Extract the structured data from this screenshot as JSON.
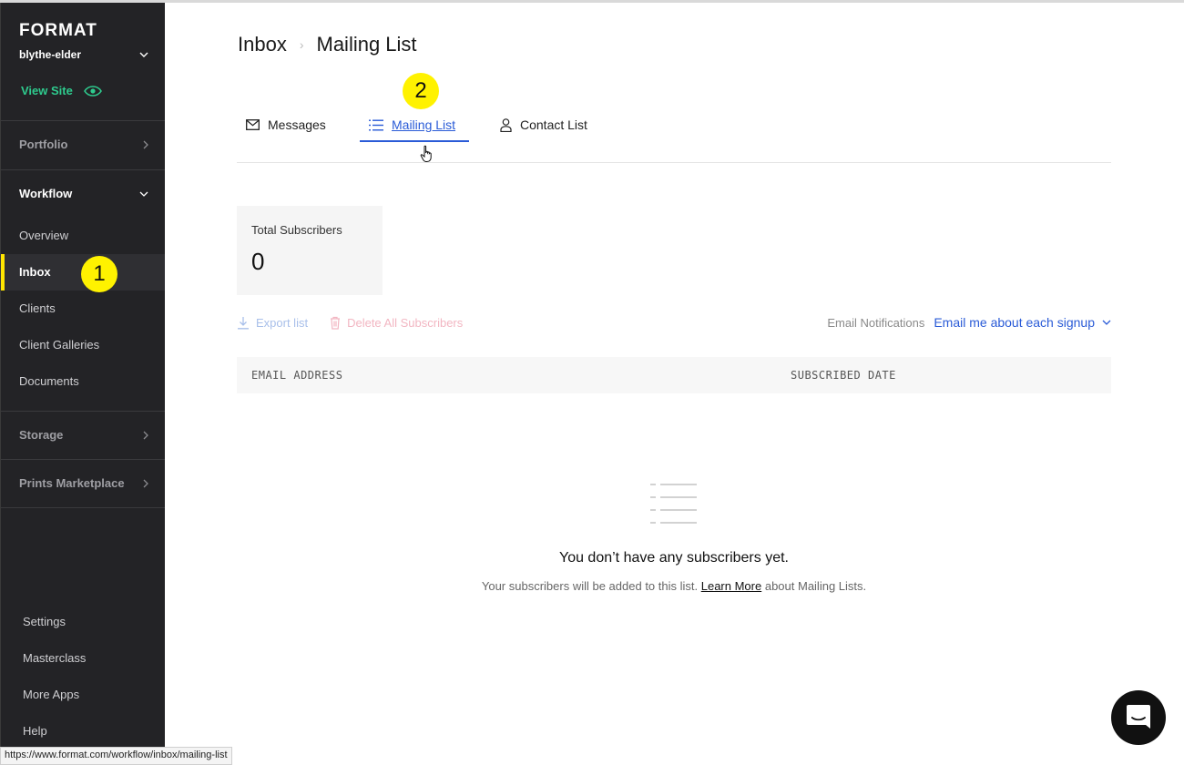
{
  "sidebar": {
    "logo": "FORMAT",
    "account_name": "blythe-elder",
    "view_site": "View Site",
    "portfolio": "Portfolio",
    "workflow": "Workflow",
    "workflow_items": [
      "Overview",
      "Inbox",
      "Clients",
      "Client Galleries",
      "Documents"
    ],
    "storage": "Storage",
    "prints_marketplace": "Prints Marketplace",
    "bottom_items": [
      "Settings",
      "Masterclass",
      "More Apps",
      "Help"
    ],
    "accent_color": "#ffe500",
    "view_site_color": "#2ecb8e"
  },
  "badges": {
    "one": "1",
    "two": "2"
  },
  "breadcrumb": {
    "parent": "Inbox",
    "current": "Mailing List"
  },
  "tabs": {
    "messages": "Messages",
    "mailing_list": "Mailing List",
    "contact_list": "Contact List",
    "active": "Mailing List"
  },
  "stats": {
    "label": "Total Subscribers",
    "value": "0"
  },
  "actions": {
    "export": "Export list",
    "delete_all": "Delete All Subscribers"
  },
  "notifications": {
    "label": "Email Notifications",
    "value": "Email me about each signup"
  },
  "table": {
    "columns": [
      "EMAIL ADDRESS",
      "SUBSCRIBED DATE"
    ]
  },
  "empty_state": {
    "title": "You don’t have any subscribers yet.",
    "subtitle_before": "Your subscribers will be added to this list.",
    "learn_more": "Learn More",
    "subtitle_after": "about Mailing Lists."
  },
  "status_url": "https://www.format.com/workflow/inbox/mailing-list",
  "colors": {
    "link_blue": "#2a5bd7",
    "sidebar_bg": "#232326"
  }
}
